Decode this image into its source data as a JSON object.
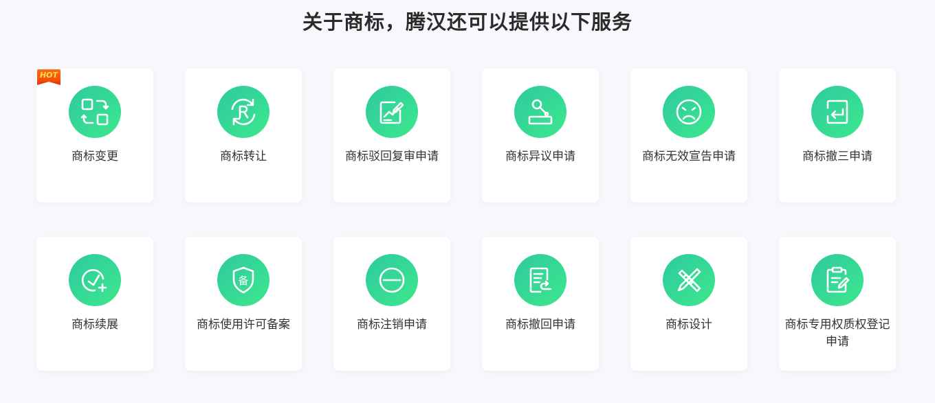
{
  "title": "关于商标，腾汉还可以提供以下服务",
  "hot_badge": "HOT",
  "accent_colors": [
    "#2ec9a0",
    "#3de88c"
  ],
  "services": [
    {
      "label": "商标变更",
      "icon": "swap-squares-icon"
    },
    {
      "label": "商标转让",
      "icon": "registered-transfer-icon"
    },
    {
      "label": "商标驳回复审申请",
      "icon": "chart-edit-icon"
    },
    {
      "label": "商标异议申请",
      "icon": "gavel-icon"
    },
    {
      "label": "商标无效宣告申请",
      "icon": "sad-face-icon"
    },
    {
      "label": "商标撤三申请",
      "icon": "exit-arrow-icon"
    },
    {
      "label": "商标续展",
      "icon": "clock-plus-icon"
    },
    {
      "label": "商标使用许可备案",
      "icon": "shield-bei-icon"
    },
    {
      "label": "商标注销申请",
      "icon": "minus-circle-icon"
    },
    {
      "label": "商标撤回申请",
      "icon": "document-return-icon"
    },
    {
      "label": "商标设计",
      "icon": "pencil-ruler-icon"
    },
    {
      "label": "商标专用权质权登记申请",
      "icon": "clipboard-edit-icon"
    }
  ]
}
